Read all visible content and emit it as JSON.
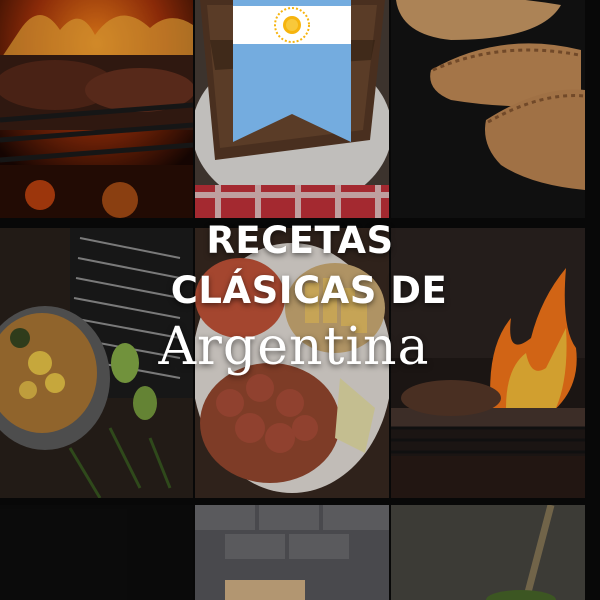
{
  "cover": {
    "title_line1": "RECETAS",
    "title_line2": "CLÁSICAS DE",
    "title_line3": "Argentina"
  },
  "colors": {
    "flag_blue": "#74ACDF",
    "flag_white": "#FFFFFF",
    "sun_gold": "#F6B40E",
    "title_text": "#FFFFFF"
  },
  "photos": [
    "asado-grill-photo",
    "sandwich-plate-photo",
    "empanadas-photo",
    "locro-stew-photo",
    "picada-platter-photo",
    "fire-grill-photo",
    "dark-tile-photo",
    "kitchen-tile-photo",
    "mate-tile-photo"
  ]
}
